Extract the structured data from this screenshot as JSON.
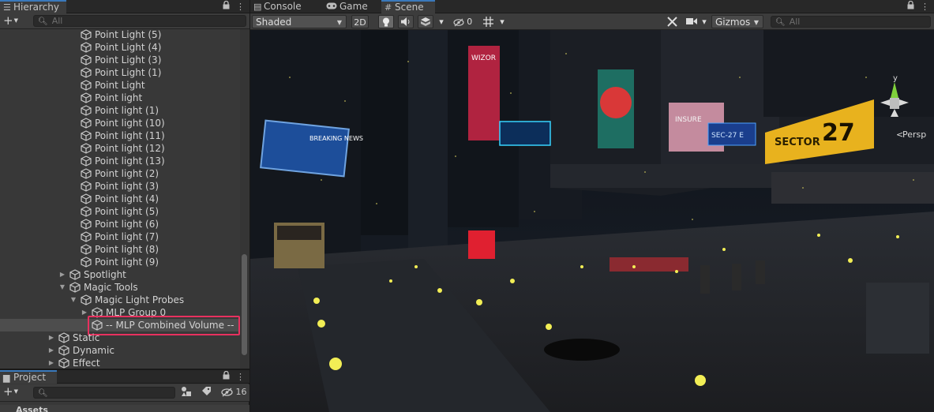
{
  "hierarchy": {
    "tab_label": "Hierarchy",
    "search_placeholder": "All",
    "rows": [
      {
        "label": "Point Light (5)"
      },
      {
        "label": "Point Light (4)"
      },
      {
        "label": "Point Light (3)"
      },
      {
        "label": "Point Light (1)"
      },
      {
        "label": "Point Light"
      },
      {
        "label": "Point light"
      },
      {
        "label": "Point light (1)"
      },
      {
        "label": "Point light (10)"
      },
      {
        "label": "Point light (11)"
      },
      {
        "label": "Point light (12)"
      },
      {
        "label": "Point light (13)"
      },
      {
        "label": "Point light (2)"
      },
      {
        "label": "Point light (3)"
      },
      {
        "label": "Point light (4)"
      },
      {
        "label": "Point light (5)"
      },
      {
        "label": "Point light (6)"
      },
      {
        "label": "Point light (7)"
      },
      {
        "label": "Point light (8)"
      },
      {
        "label": "Point light (9)"
      },
      {
        "label": "Spotlight"
      },
      {
        "label": "Magic Tools"
      },
      {
        "label": "Magic Light Probes"
      },
      {
        "label": "MLP Group 0"
      },
      {
        "label": "-- MLP Combined Volume --"
      },
      {
        "label": "Static"
      },
      {
        "label": "Dynamic"
      },
      {
        "label": "Effect"
      }
    ],
    "selected_item": "-- MLP Combined Volume --",
    "highlight_color": "#e8315f"
  },
  "project": {
    "tab_label": "Project",
    "hidden_count": "16",
    "root_folder": "Assets"
  },
  "tabs": {
    "console": "Console",
    "game": "Game",
    "scene": "Scene"
  },
  "scene_toolbar": {
    "draw_mode": "Shaded",
    "mode_2d": "2D",
    "hidden_count": "0",
    "gizmos_label": "Gizmos",
    "search_placeholder": "All"
  },
  "scene_view": {
    "projection_label": "Persp",
    "axis_y": "y",
    "billboard_sector_label": "SECTOR",
    "billboard_sector_number": "27",
    "billboard_news_text": "BREAKING NEWS",
    "sign_sec": "SEC-27 E",
    "sign_insure": "INSURE",
    "sign_wizor": "WIZOR"
  },
  "icons": {
    "hierarchy": "list-icon",
    "project": "folder-icon",
    "console": "console-icon",
    "game": "gamepad-icon",
    "scene": "grid-icon",
    "lock": "lock-icon",
    "more": "kebab-icon",
    "object": "cube-icon",
    "gizmo": "orientation-gizmo-icon"
  },
  "colors": {
    "accent_tab": "#3a79bb",
    "panel_bg": "#383838",
    "toolbar_bg": "#3c3c3c",
    "selection_highlight": "#e8315f"
  }
}
